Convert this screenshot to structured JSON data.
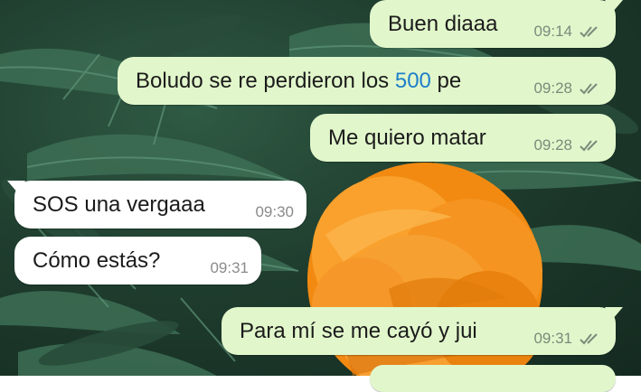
{
  "chat": {
    "messages": [
      {
        "direction": "out",
        "text": "Buen diaaa",
        "time": "09:14",
        "status": "read-double-check"
      },
      {
        "direction": "out",
        "text_before": "Boludo se re perdieron los ",
        "text_highlight": "500",
        "text_after": " pe",
        "time": "09:28",
        "status": "read-double-check"
      },
      {
        "direction": "out",
        "text": "Me quiero matar",
        "time": "09:28",
        "status": "read-double-check"
      },
      {
        "direction": "in",
        "text": "SOS una vergaaa",
        "time": "09:30"
      },
      {
        "direction": "in",
        "text": "Cómo estás?",
        "time": "09:31"
      },
      {
        "direction": "out",
        "text": "Para mí se me cayó y jui",
        "time": "09:31",
        "status": "read-double-check"
      }
    ]
  },
  "colors": {
    "outgoing_bubble": "#e1f7cb",
    "incoming_bubble": "#ffffff",
    "number_link": "#1e7fc9",
    "wallpaper_leaves": "#2f5a44",
    "wallpaper_flower": "#f7931e"
  },
  "icons": {
    "tick": "double-check-icon",
    "wallpaper": "marigold-flower-leaves-wallpaper"
  }
}
